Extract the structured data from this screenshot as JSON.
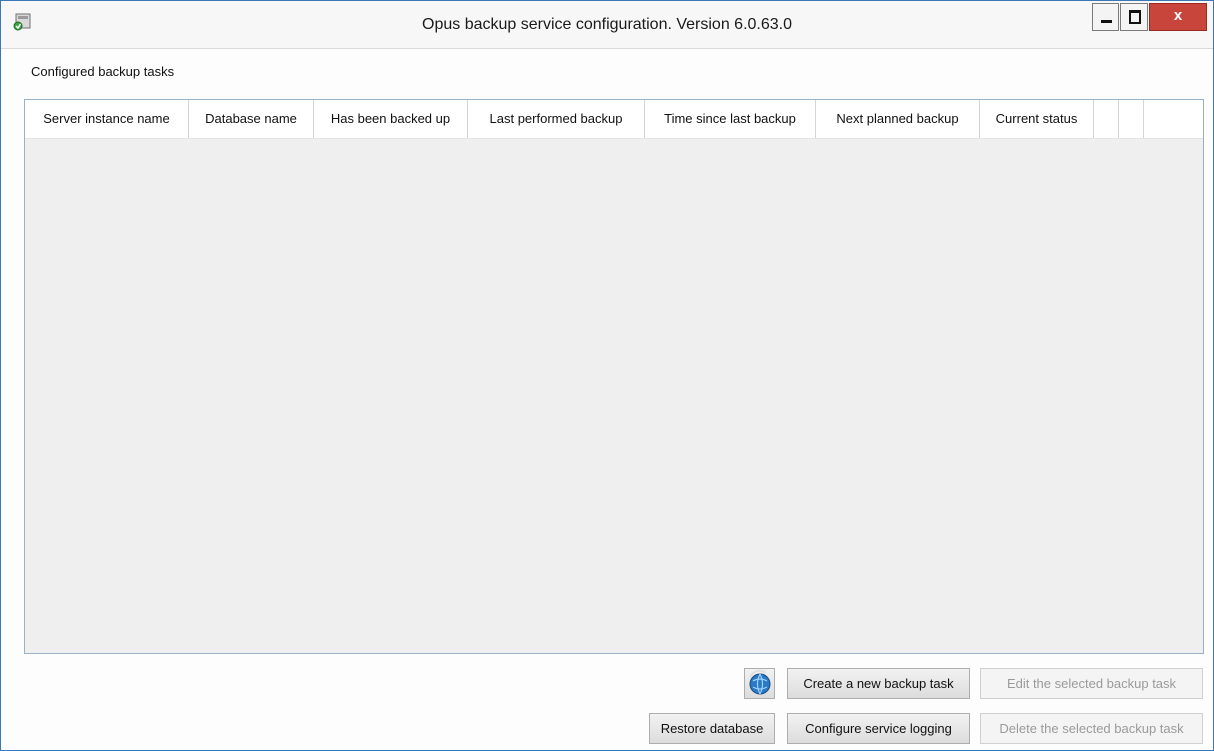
{
  "window": {
    "title": "Opus backup service configuration. Version 6.0.63.0",
    "close_glyph": "x"
  },
  "main": {
    "section_label": "Configured backup tasks",
    "columns": [
      "Server instance name",
      "Database name",
      "Has been backed up",
      "Last performed backup",
      "Time since last backup",
      "Next planned backup",
      "Current status",
      "",
      ""
    ],
    "rows": []
  },
  "buttons": {
    "create_task": "Create a new backup task",
    "edit_task": "Edit the selected backup task",
    "restore_db": "Restore database",
    "configure_logging": "Configure service logging",
    "delete_task": "Delete the selected backup task"
  },
  "icons": {
    "app": "backup-app-icon",
    "refresh": "refresh-globe-icon"
  },
  "colors": {
    "window_border": "#3a78b4",
    "close_button": "#c8453c",
    "grid_background": "#efefef"
  }
}
